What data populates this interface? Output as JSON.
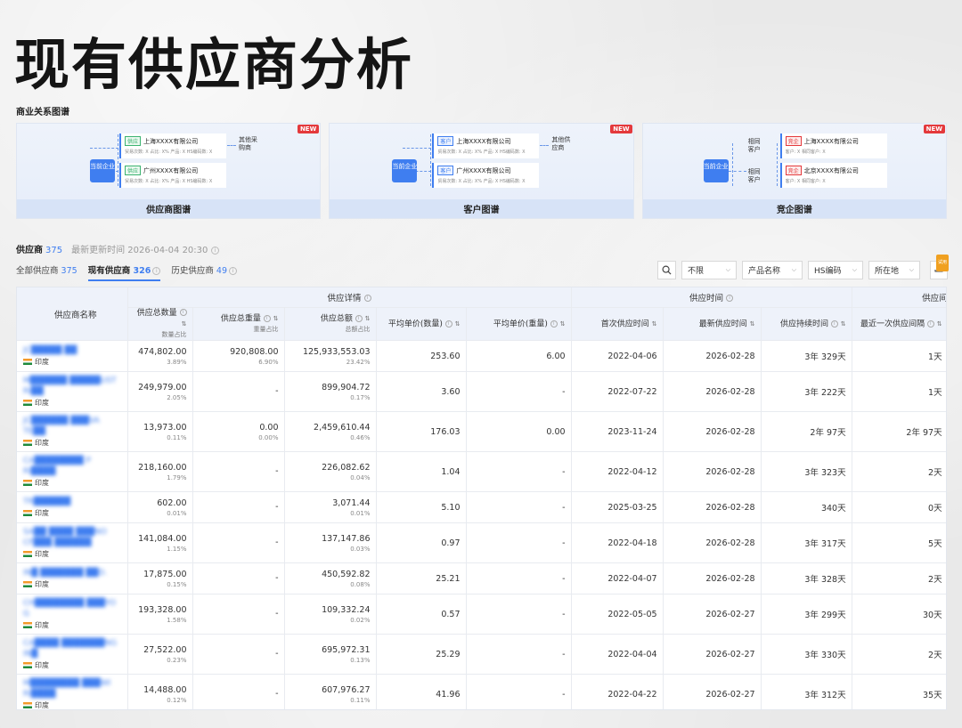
{
  "page_title": "现有供应商分析",
  "section_label": "商业关系图谱",
  "cards": [
    {
      "footer": "供应商图谱",
      "new": "NEW",
      "center": "当前企业",
      "side": "其他采购商",
      "nodes": [
        {
          "tag": "供应",
          "name": "上海XXXX有限公司",
          "meta": "贸易次数: X  占比: X%  产品: X  HS编码数: X"
        },
        {
          "tag": "供应",
          "name": "广州XXXX有限公司",
          "meta": "贸易次数: X  占比: X%  产品: X  HS编码数: X"
        }
      ]
    },
    {
      "footer": "客户图谱",
      "new": "NEW",
      "center": "当前企业",
      "side": "其他供应商",
      "nodes": [
        {
          "tag": "客户",
          "name": "上海XXXX有限公司",
          "meta": "贸易次数: X  占比: X%  产品: X  HS编码数: X"
        },
        {
          "tag": "客户",
          "name": "广州XXXX有限公司",
          "meta": "贸易次数: X  占比: X%  产品: X  HS编码数: X"
        }
      ]
    },
    {
      "footer": "竞企图谱",
      "new": "NEW",
      "center": "当前企业",
      "relations": [
        "相同客户",
        "相同客户"
      ],
      "nodes": [
        {
          "tag": "竞企",
          "name": "上海XXXX有限公司",
          "meta": "客户: X  相同客户: X"
        },
        {
          "tag": "竞企",
          "name": "北京XXXX有限公司",
          "meta": "客户: X  相同客户: X"
        }
      ]
    }
  ],
  "supplier_header": {
    "title": "供应商",
    "count": "375",
    "updated": "最新更新时间 2026-04-04 20:30"
  },
  "tabs": [
    {
      "label": "全部供应商",
      "count": "375"
    },
    {
      "label": "现有供应商",
      "count": "326"
    },
    {
      "label": "历史供应商",
      "count": "49"
    }
  ],
  "filters": {
    "limit": "不限",
    "product": "产品名称",
    "hs": "HS编码",
    "location": "所在地",
    "export_badge": "试用"
  },
  "table": {
    "group_headers": [
      "供应商名称",
      "供应详情",
      "供应时间",
      "供应间"
    ],
    "columns": [
      {
        "label": "供应总数量",
        "sub": "数量占比"
      },
      {
        "label": "供应总重量",
        "sub": "重量占比"
      },
      {
        "label": "供应总额",
        "sub": "总额占比"
      },
      {
        "label": "平均单价(数量)",
        "sub": ""
      },
      {
        "label": "平均单价(重量)",
        "sub": ""
      },
      {
        "label": "首次供应时间",
        "sub": ""
      },
      {
        "label": "最新供应时间",
        "sub": ""
      },
      {
        "label": "供应持续时间",
        "sub": ""
      },
      {
        "label": "最近一次供应间隔",
        "sub": ""
      }
    ],
    "rows": [
      {
        "name": "JC█████ ██",
        "country": "印度",
        "qty": "474,802.00",
        "qty_pct": "3.89%",
        "wt": "920,808.00",
        "wt_pct": "6.90%",
        "amt": "125,933,553.03",
        "amt_pct": "23.42%",
        "avg_q": "253.60",
        "avg_w": "6.00",
        "first": "2022-04-06",
        "last": "2026-02-28",
        "dur": "3年 329天",
        "gap": "1天"
      },
      {
        "name": "M██████ █████UST RI██",
        "country": "印度",
        "qty": "249,979.00",
        "qty_pct": "2.05%",
        "wt": "-",
        "wt_pct": "",
        "amt": "899,904.72",
        "amt_pct": "0.17%",
        "avg_q": "3.60",
        "avg_w": "-",
        "first": "2022-07-22",
        "last": "2026-02-28",
        "dur": "3年 222天",
        "gap": "1天"
      },
      {
        "name": "JC██████ ███VA TE██",
        "country": "印度",
        "qty": "13,973.00",
        "qty_pct": "0.11%",
        "wt": "0.00",
        "wt_pct": "0.00%",
        "amt": "2,459,610.44",
        "amt_pct": "0.46%",
        "avg_q": "176.03",
        "avg_w": "0.00",
        "first": "2023-11-24",
        "last": "2026-02-28",
        "dur": "2年 97天",
        "gap": "2年 97天"
      },
      {
        "name": "CA████████ P RI████",
        "country": "印度",
        "qty": "218,160.00",
        "qty_pct": "1.79%",
        "wt": "-",
        "wt_pct": "",
        "amt": "226,082.62",
        "amt_pct": "0.04%",
        "avg_q": "1.04",
        "avg_w": "-",
        "first": "2022-04-12",
        "last": "2026-02-28",
        "dur": "3年 323天",
        "gap": "2天"
      },
      {
        "name": "TR██████",
        "country": "印度",
        "qty": "602.00",
        "qty_pct": "0.01%",
        "wt": "-",
        "wt_pct": "",
        "amt": "3,071.44",
        "amt_pct": "0.01%",
        "avg_q": "5.10",
        "avg_w": "-",
        "first": "2025-03-25",
        "last": "2026-02-28",
        "dur": "340天",
        "gap": "0天"
      },
      {
        "name": "SA██ ████ ███NO CF███ ██████",
        "country": "印度",
        "qty": "141,084.00",
        "qty_pct": "1.15%",
        "wt": "-",
        "wt_pct": "",
        "amt": "137,147.86",
        "amt_pct": "0.03%",
        "avg_q": "0.97",
        "avg_w": "-",
        "first": "2022-04-18",
        "last": "2026-02-28",
        "dur": "3年 317天",
        "gap": "5天"
      },
      {
        "name": "IN█ ███████ ██D.",
        "country": "印度",
        "qty": "17,875.00",
        "qty_pct": "0.15%",
        "wt": "-",
        "wt_pct": "",
        "amt": "450,592.82",
        "amt_pct": "0.08%",
        "avg_q": "25.21",
        "avg_w": "-",
        "first": "2022-04-07",
        "last": "2026-02-28",
        "dur": "3年 328天",
        "gap": "2天"
      },
      {
        "name": "CH████████ ███YO G",
        "country": "印度",
        "qty": "193,328.00",
        "qty_pct": "1.58%",
        "wt": "-",
        "wt_pct": "",
        "amt": "109,332.24",
        "amt_pct": "0.02%",
        "avg_q": "0.57",
        "avg_w": "-",
        "first": "2022-05-05",
        "last": "2026-02-27",
        "dur": "3年 299天",
        "gap": "30天"
      },
      {
        "name": "CA████ ███████NG IN█",
        "country": "印度",
        "qty": "27,522.00",
        "qty_pct": "0.23%",
        "wt": "-",
        "wt_pct": "",
        "amt": "695,972.31",
        "amt_pct": "0.13%",
        "avg_q": "25.29",
        "avg_w": "-",
        "first": "2022-04-04",
        "last": "2026-02-27",
        "dur": "3年 330天",
        "gap": "2天"
      },
      {
        "name": "M████████ ███WI RI████",
        "country": "印度",
        "qty": "14,488.00",
        "qty_pct": "0.12%",
        "wt": "-",
        "wt_pct": "",
        "amt": "607,976.27",
        "amt_pct": "0.11%",
        "avg_q": "41.96",
        "avg_w": "-",
        "first": "2022-04-22",
        "last": "2026-02-27",
        "dur": "3年 312天",
        "gap": "35天"
      }
    ]
  }
}
